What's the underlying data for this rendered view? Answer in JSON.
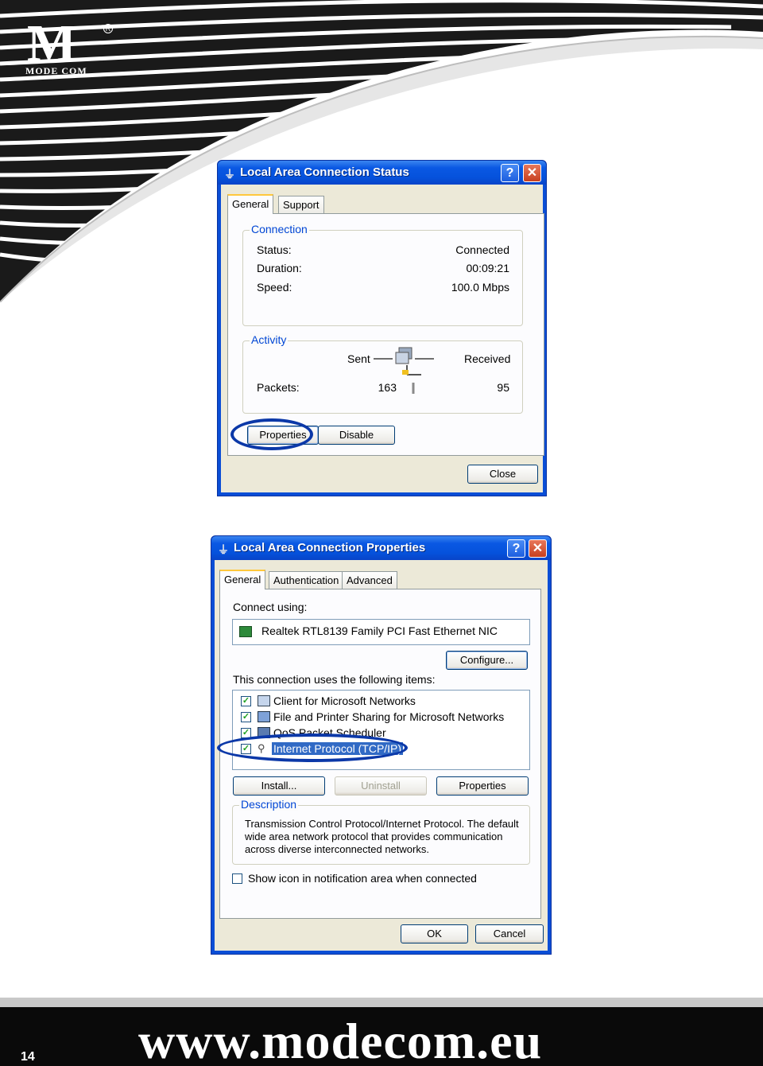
{
  "brand": {
    "logo_letter": "M",
    "logo_text": "MODE COM",
    "logo_reg": "R"
  },
  "status_dialog": {
    "title": "Local Area Connection Status",
    "tabs": [
      "General",
      "Support"
    ],
    "connection": {
      "group_title": "Connection",
      "rows": [
        {
          "label": "Status:",
          "value": "Connected"
        },
        {
          "label": "Duration:",
          "value": "00:09:21"
        },
        {
          "label": "Speed:",
          "value": "100.0 Mbps"
        }
      ]
    },
    "activity": {
      "group_title": "Activity",
      "sent_label": "Sent",
      "received_label": "Received",
      "packets_label": "Packets:",
      "packets_sent": "163",
      "packets_received": "95"
    },
    "buttons": {
      "properties": "Properties",
      "disable": "Disable",
      "close": "Close"
    },
    "highlight_target": "properties"
  },
  "properties_dialog": {
    "title": "Local Area Connection Properties",
    "tabs": [
      "General",
      "Authentication",
      "Advanced"
    ],
    "connect_using_label": "Connect using:",
    "adapter": "Realtek RTL8139 Family PCI Fast Ethernet NIC",
    "configure_button": "Configure...",
    "items_label": "This connection uses the following items:",
    "items": [
      {
        "label": "Client for Microsoft Networks",
        "checked": true
      },
      {
        "label": "File and Printer Sharing for Microsoft Networks",
        "checked": true
      },
      {
        "label": "QoS Packet Scheduler",
        "checked": true
      },
      {
        "label": "Internet Protocol (TCP/IP)",
        "checked": true,
        "selected": true
      }
    ],
    "buttons": {
      "install": "Install...",
      "uninstall": "Uninstall",
      "properties": "Properties",
      "ok": "OK",
      "cancel": "Cancel"
    },
    "description": {
      "group_title": "Description",
      "lines": [
        "Transmission Control Protocol/Internet Protocol. The default",
        "wide area network protocol that provides communication",
        "across diverse interconnected networks."
      ]
    },
    "show_icon_label": "Show icon in notification area when connected",
    "show_icon_checked": false
  },
  "footer": {
    "page_number": "14",
    "url": "www.modecom.eu"
  },
  "colors": {
    "xp_blue": "#0a4ed6",
    "highlight_ring": "#0b38a8",
    "footer_bg": "#0a0a0a"
  }
}
